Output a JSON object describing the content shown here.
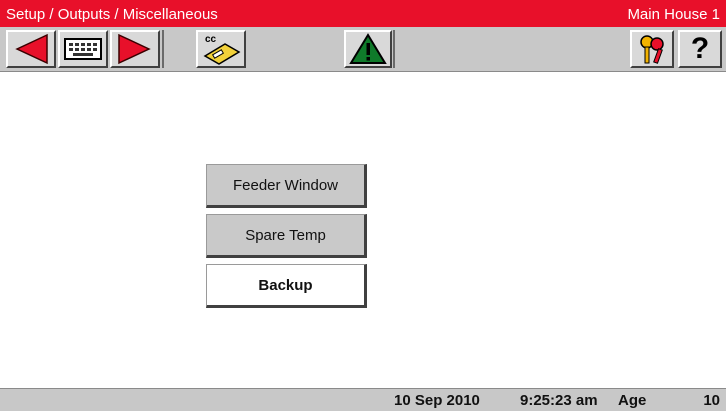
{
  "header": {
    "breadcrumb": "Setup / Outputs / Miscellaneous",
    "house": "Main House 1"
  },
  "toolbar": {
    "buttons": [
      {
        "icon": "arrow-left-icon"
      },
      {
        "icon": "keyboard-icon"
      },
      {
        "icon": "arrow-right-icon"
      },
      {
        "icon": "cc-card-icon",
        "label": "cc"
      },
      {
        "icon": "alarm-warning-icon"
      },
      {
        "icon": "keys-icon"
      },
      {
        "icon": "help-icon",
        "label": "?"
      }
    ]
  },
  "menu": {
    "items": [
      {
        "label": "Feeder Window",
        "active": false
      },
      {
        "label": "Spare Temp",
        "active": false
      },
      {
        "label": "Backup",
        "active": true
      }
    ]
  },
  "status": {
    "date": "10 Sep 2010",
    "time": "9:25:23 am",
    "age_label": "Age",
    "age_value": "10"
  },
  "colors": {
    "title_bar": "#e8102a",
    "arrow": "#e8102a",
    "warning": "#0f7a2a",
    "panel": "#c8c8c8"
  }
}
